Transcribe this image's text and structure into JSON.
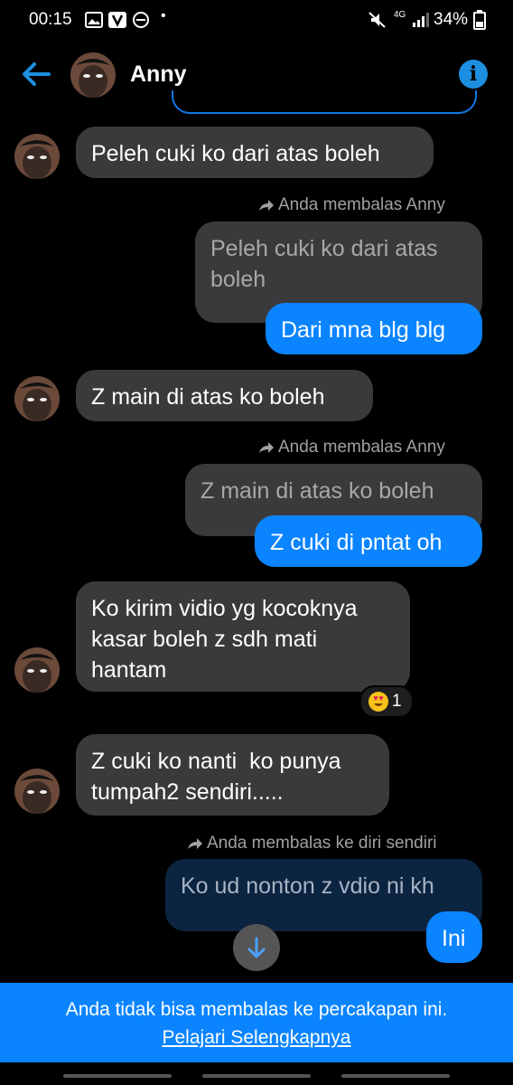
{
  "status_bar": {
    "time": "00:15",
    "battery": "34%",
    "network": "4G"
  },
  "header": {
    "name": "Anny"
  },
  "messages": {
    "m1": "Peleh cuki ko dari atas boleh",
    "r1_label": "Anda membalas Anny",
    "r1_quote": "Peleh cuki ko dari atas\nboleh",
    "r1_reply": "Dari mna blg blg",
    "m2": "Z main di atas ko boleh",
    "r2_label": "Anda membalas Anny",
    "r2_quote": "Z main di atas ko boleh",
    "r2_reply": "Z cuki di pntat oh",
    "m3": "Ko kirim vidio yg kocoknya\nkasar boleh z sdh mati\nhantam",
    "m3_reaction_count": "1",
    "m4": "Z cuki ko nanti  ko punya\ntumpah2 sendiri.....",
    "r3_label": "Anda membalas ke diri sendiri",
    "r3_quote": "Ko ud nonton z vdio ni kh",
    "r3_reply": "Ini"
  },
  "footer": {
    "notice": "Anda tidak bisa membalas ke percakapan ini.",
    "link": "Pelajari Selengkapnya"
  },
  "colors": {
    "accent": "#0a84ff",
    "incoming": "#3a3a3c",
    "background": "#000000"
  }
}
